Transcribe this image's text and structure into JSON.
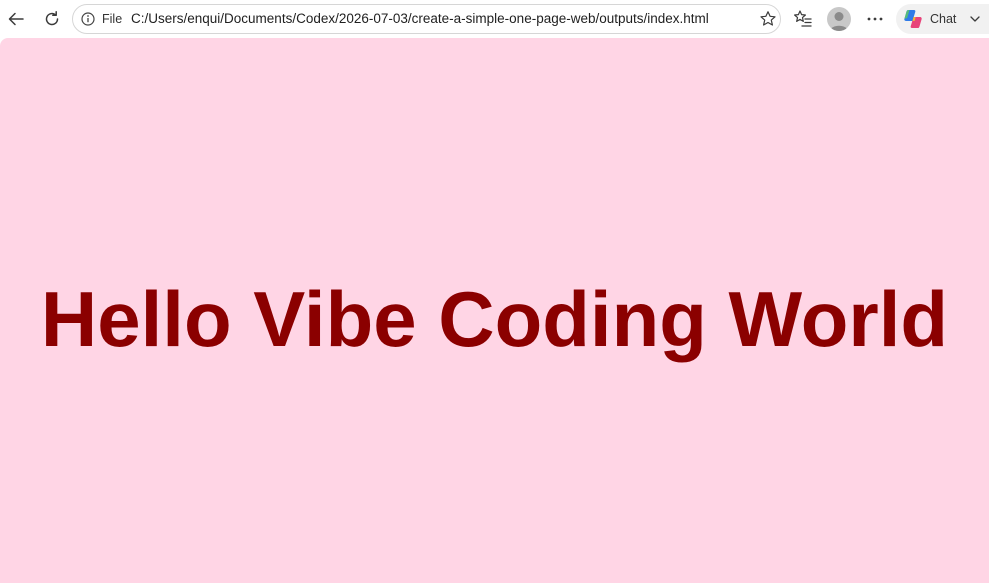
{
  "browser": {
    "address_bar": {
      "scheme_label": "File",
      "url": "C:/Users/enqui/Documents/Codex/2026-07-03/create-a-simple-one-page-web/outputs/index.html"
    },
    "chat_button": {
      "label": "Chat"
    },
    "icons": {
      "back": "back-arrow-icon",
      "reload": "reload-icon",
      "info": "info-icon",
      "star": "star-icon",
      "favorites": "favorites-icon",
      "profile": "profile-avatar",
      "more": "more-options-icon",
      "copilot": "copilot-icon",
      "chevron": "chevron-down-icon"
    }
  },
  "page": {
    "headline": "Hello Vibe Coding World",
    "background_color": "#ffd5e5",
    "text_color": "#8b0000"
  }
}
